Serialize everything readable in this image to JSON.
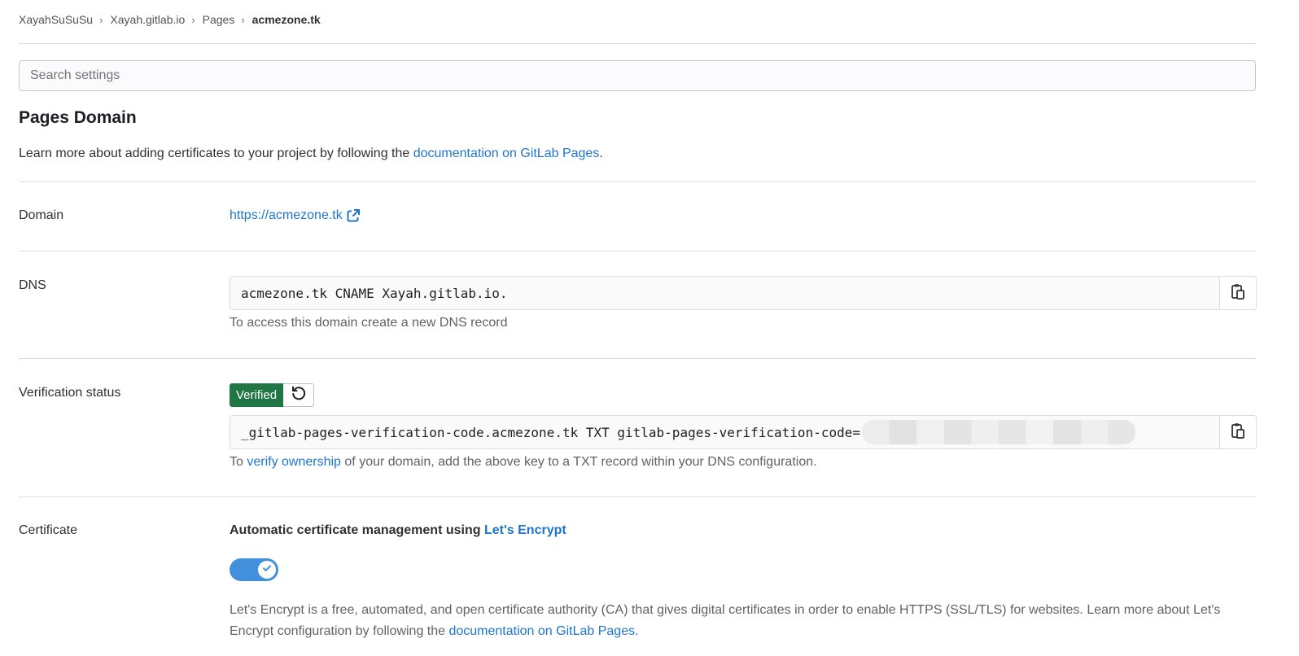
{
  "breadcrumb": {
    "items": [
      "XayahSuSuSu",
      "Xayah.gitlab.io",
      "Pages",
      "acmezone.tk"
    ],
    "separator": "›"
  },
  "search": {
    "placeholder": "Search settings",
    "value": ""
  },
  "page": {
    "title": "Pages Domain",
    "intro_prefix": "Learn more about adding certificates to your project by following the ",
    "intro_link": "documentation on GitLab Pages",
    "intro_suffix": "."
  },
  "domain": {
    "label": "Domain",
    "url": "https://acmezone.tk",
    "icon": "external-link-icon"
  },
  "dns": {
    "label": "DNS",
    "record": "acmezone.tk CNAME Xayah.gitlab.io.",
    "help": "To access this domain create a new DNS record",
    "copy_icon": "copy-to-clipboard-icon"
  },
  "verification": {
    "label": "Verification status",
    "badge": "Verified",
    "retry_icon": "retry-icon",
    "record": "_gitlab-pages-verification-code.acmezone.tk TXT gitlab-pages-verification-code=",
    "help_prefix": "To ",
    "help_link": "verify ownership",
    "help_suffix": " of your domain, add the above key to a TXT record within your DNS configuration.",
    "copy_icon": "copy-to-clipboard-icon"
  },
  "certificate": {
    "label": "Certificate",
    "heading_prefix": "Automatic certificate management using ",
    "heading_link": "Let's Encrypt",
    "toggle_on": true,
    "desc_prefix": "Let's Encrypt is a free, automated, and open certificate authority (CA) that gives digital certificates in order to enable HTTPS (SSL/TLS) for websites. Learn more about Let's Encrypt configuration by following the ",
    "desc_link": "documentation on GitLab Pages",
    "desc_suffix": "."
  },
  "colors": {
    "link": "#1f75cb",
    "verified_badge": "#217645",
    "toggle_on": "#428fdc"
  }
}
